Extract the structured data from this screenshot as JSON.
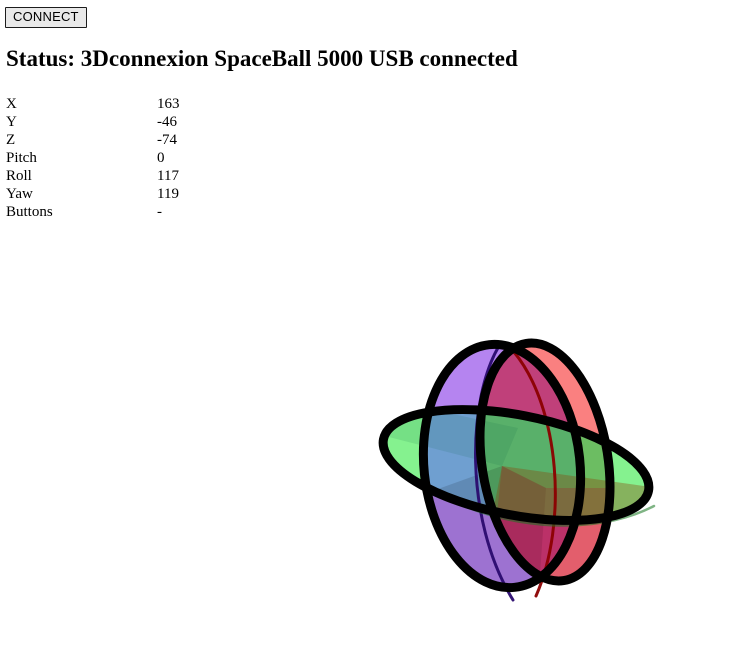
{
  "toolbar": {
    "connect_label": "CONNECT"
  },
  "status": {
    "prefix": "Status:",
    "device": "3Dconnexion SpaceBall 5000 USB",
    "state": "connected",
    "full_text": "Status: 3Dconnexion SpaceBall 5000 USB connected"
  },
  "telemetry": {
    "rows": [
      {
        "label": "X",
        "value": "163"
      },
      {
        "label": "Y",
        "value": "-46"
      },
      {
        "label": "Z",
        "value": "-74"
      },
      {
        "label": "Pitch",
        "value": "0"
      },
      {
        "label": "Roll",
        "value": "117"
      },
      {
        "label": "Yaw",
        "value": "119"
      },
      {
        "label": "Buttons",
        "value": "-"
      }
    ]
  },
  "widget": {
    "name": "3d-orientation-gizmo",
    "outline_color": "#000000",
    "discs": [
      {
        "axis": "x",
        "name": "red-disc",
        "color": "#ff4040",
        "edge_color": "#8b0000"
      },
      {
        "axis": "y",
        "name": "green-disc",
        "color": "#40e060",
        "edge_color": "#15761f"
      },
      {
        "axis": "z",
        "name": "violet-disc",
        "color": "#8a40f0",
        "edge_color": "#2a0a6e"
      }
    ],
    "blend_samples": {
      "red_only": "#fa8080",
      "green_only": "#85f28f",
      "violet_only": "#b584f0",
      "red_green": "#b0704a",
      "red_violet": "#c0407a",
      "green_violet": "#6f85c8",
      "all_three": "#b04a6a"
    }
  }
}
